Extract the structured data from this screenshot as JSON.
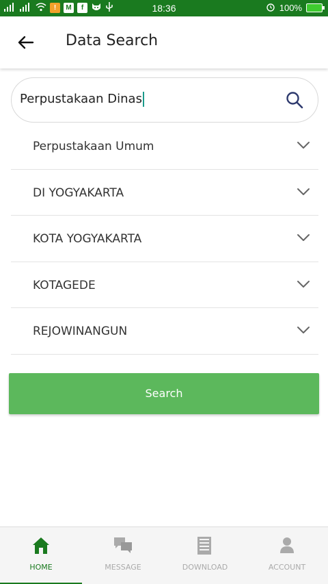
{
  "status_bar": {
    "time": "18:36",
    "battery": "100%",
    "left_icons": [
      "signal-icon",
      "signal-icon",
      "wifi-icon",
      "notification-icon",
      "mail-icon",
      "facebook-icon",
      "cat-icon",
      "usb-icon"
    ],
    "right_icons": [
      "alarm-icon",
      "battery-icon"
    ]
  },
  "app_bar": {
    "title": "Data Search",
    "back_icon": "back-arrow-icon"
  },
  "search": {
    "value": "Perpustakaan Dinas",
    "icon": "search-icon"
  },
  "dropdowns": [
    {
      "label": "Perpustakaan Umum"
    },
    {
      "label": "DI YOGYAKARTA"
    },
    {
      "label": "KOTA YOGYAKARTA"
    },
    {
      "label": "KOTAGEDE"
    },
    {
      "label": "REJOWINANGUN"
    }
  ],
  "search_button": {
    "label": "Search"
  },
  "bottom_nav": [
    {
      "label": "HOME",
      "icon": "home-icon",
      "active": true
    },
    {
      "label": "MESSAGE",
      "icon": "message-icon",
      "active": false
    },
    {
      "label": "DOWNLOAD",
      "icon": "download-icon",
      "active": false
    },
    {
      "label": "ACCOUNT",
      "icon": "account-icon",
      "active": false
    }
  ],
  "colors": {
    "primary": "#1a7a1f",
    "button": "#5cb85c",
    "inactive": "#aaaaaa"
  }
}
